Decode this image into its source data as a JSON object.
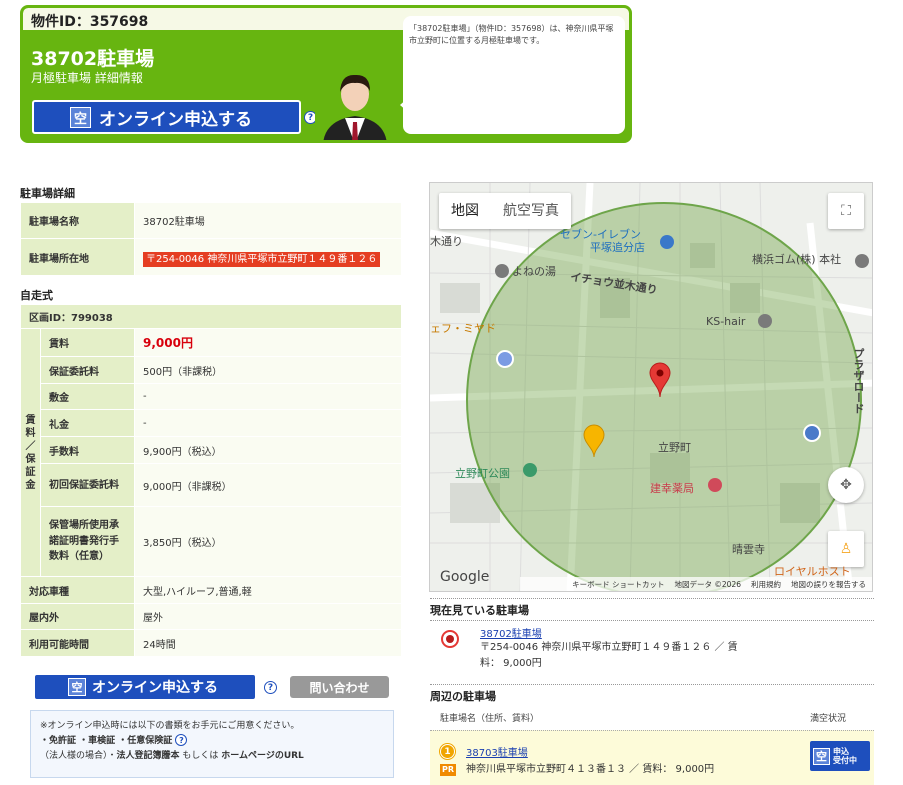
{
  "header": {
    "property_id": "物件ID：357698",
    "title": "38702駐車場",
    "subtitle": "月極駐車場 詳細情報",
    "apply_icon": "空",
    "apply_label": "オンライン申込する",
    "help_icon": "?",
    "bubble_text": "「38702駐車場」（物件ID：357698）は、神奈川県平塚市立野町に位置する月極駐車場です。"
  },
  "details": {
    "section_title": "駐車場詳細",
    "rows": [
      {
        "label": "駐車場名称",
        "value": "38702駐車場"
      },
      {
        "label": "駐車場所在地",
        "value": "〒254-0046 神奈川県平塚市立野町１４９番１２６"
      }
    ]
  },
  "jisou": {
    "section_title": "自走式",
    "block_id": "区画ID：799038",
    "group_label": [
      "賃",
      "料",
      "／",
      "保",
      "証",
      "金"
    ],
    "fees": [
      {
        "label": "賃料",
        "value": "9,000円"
      },
      {
        "label": "保証委託料",
        "value": "500円（非課税）"
      },
      {
        "label": "敷金",
        "value": "-"
      },
      {
        "label": "礼金",
        "value": "-"
      },
      {
        "label": "手数料",
        "value": "9,900円（税込）"
      },
      {
        "label": "初回保証委託料",
        "value": "9,000円（非課税）"
      },
      {
        "label": "保管場所使用承諾証明書発行手数料（任意）",
        "value": "3,850円（税込）"
      }
    ],
    "other": [
      {
        "label": "対応車種",
        "value": "大型,ハイルーフ,普通,軽"
      },
      {
        "label": "屋内外",
        "value": "屋外"
      },
      {
        "label": "利用可能時間",
        "value": "24時間"
      }
    ]
  },
  "actions": {
    "apply_icon": "空",
    "apply_label": "オンライン申込する",
    "help_icon": "?",
    "contact_label": "問い合わせ"
  },
  "note": {
    "line1": "※オンライン申込時には以下の書類をお手元にご用意ください。",
    "line2": "・免許証 ・車検証 ・任意保険証",
    "line3a": "（法人様の場合）・",
    "line3b": "法人登記簿謄本",
    "line3c": " もしくは ",
    "line3d": "ホームページのURL"
  },
  "map": {
    "tab_map": "地図",
    "tab_aerial": "航空写真",
    "labels": {
      "seven": "セブン-イレブン",
      "seven2": "平塚追分店",
      "road1": "木通り",
      "yoneno": "よねの湯",
      "ichou": "イチョウ並木通り",
      "yokohama": "横浜ゴム(株) 本社",
      "miyado": "ェフ・ミヤド",
      "kshair": "KS-hair",
      "plaza": "プラザロード",
      "tateno": "立野町",
      "park": "立野町公園",
      "pharmacy": "建幸薬局",
      "temple": "晴雲寺",
      "royal": "ロイヤルホスト",
      "google": "Google"
    },
    "footer": [
      "キーボード ショートカット",
      "地図データ ©2026",
      "利用規約",
      "地図の誤りを報告する"
    ]
  },
  "current": {
    "title": "現在見ている駐車場",
    "name": "38702駐車場",
    "address": "〒254-0046 神奈川県平塚市立野町１４９番１２６ ／ 賃",
    "price": "料： 9,000円"
  },
  "nearby": {
    "title": "周辺の駐車場",
    "col_name": "駐車場名（住所、賃料）",
    "col_status": "満空状況",
    "items": [
      {
        "badge": "1",
        "pr": "PR",
        "name": "38703駐車場",
        "address": "神奈川県平塚市立野町４１３番１３ ／ 賃料： 9,000円",
        "status_icon": "空",
        "status_text1": "申込",
        "status_text2": "受付中"
      }
    ]
  }
}
